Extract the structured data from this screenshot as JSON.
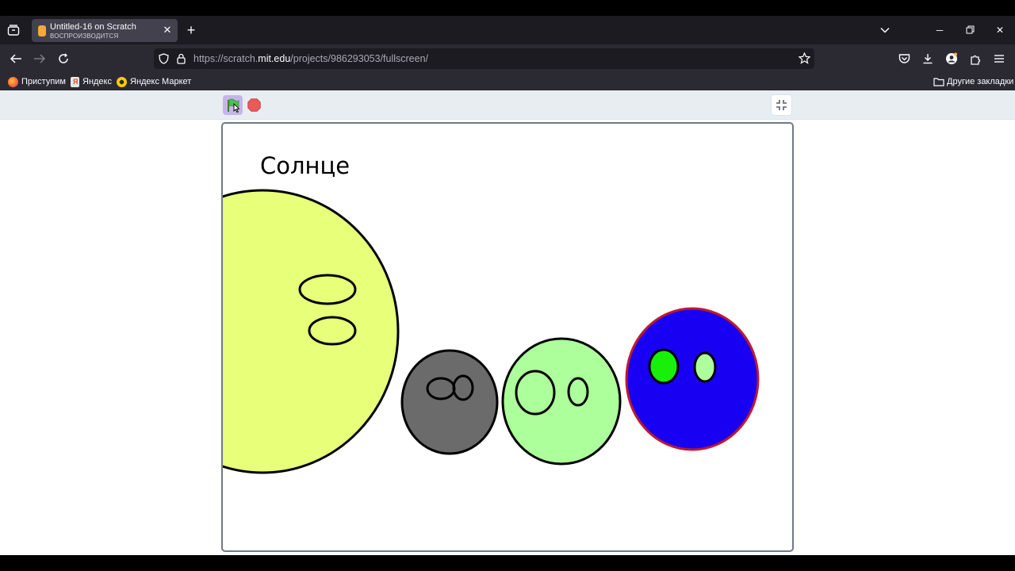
{
  "browser": {
    "tab": {
      "title": "Untitled-16 on Scratch",
      "subtitle": "ВОСПРОИЗВОДИТСЯ"
    },
    "url": {
      "prefix": "https://scratch.",
      "domain": "mit.edu",
      "path": "/projects/986293053/fullscreen/"
    },
    "bookmarks": [
      {
        "label": "Приступим",
        "icon": "firefox-icon"
      },
      {
        "label": "Яндекс",
        "icon": "yandex-icon"
      },
      {
        "label": "Яндекс Маркет",
        "icon": "yandex-market-icon"
      }
    ],
    "other_bookmarks": "Другие закладки"
  },
  "scratch": {
    "stage_label": "Солнце",
    "colors": {
      "sun": "#e8ff7a",
      "moon": "#6b6b6b",
      "light_green_planet": "#adff9b",
      "blue_planet": "#1800f2",
      "blue_planet_outline": "#c0182e",
      "bright_green_eye": "#19f00a"
    }
  }
}
